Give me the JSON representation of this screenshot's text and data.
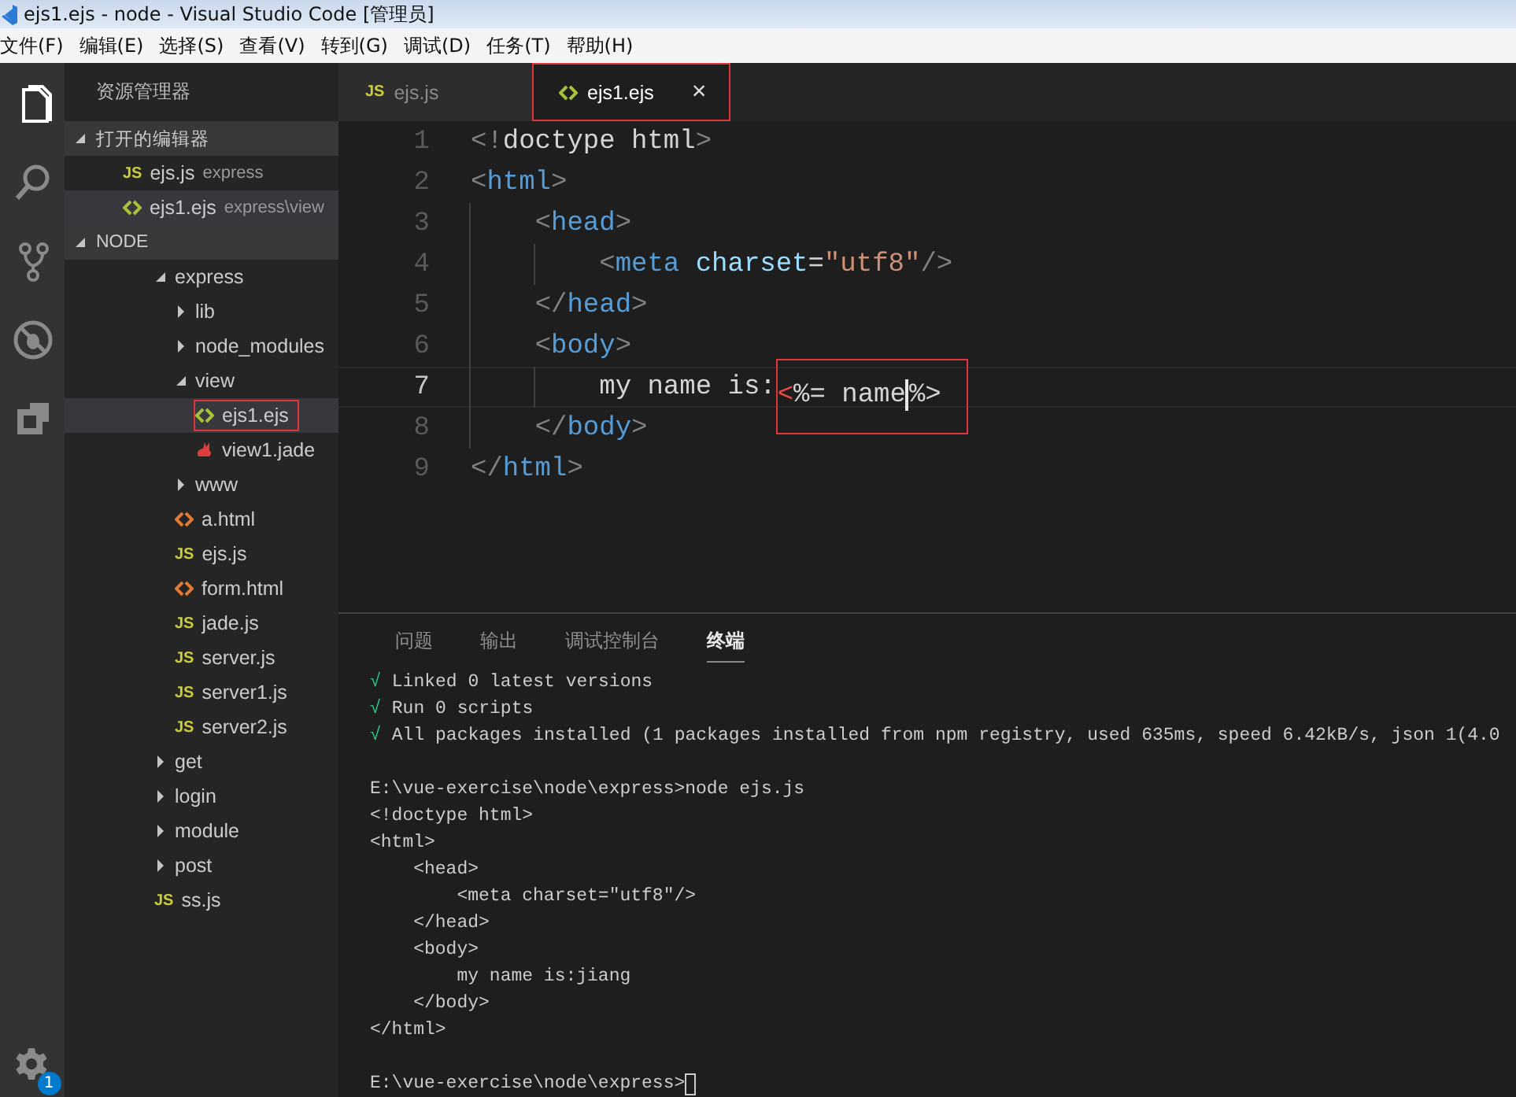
{
  "window": {
    "title": "ejs1.ejs - node - Visual Studio Code [管理员]"
  },
  "menu": [
    "文件(F)",
    "编辑(E)",
    "选择(S)",
    "查看(V)",
    "转到(G)",
    "调试(D)",
    "任务(T)",
    "帮助(H)"
  ],
  "activity_bar": {
    "items": [
      {
        "kind": "files",
        "selected": true
      },
      {
        "kind": "search",
        "selected": false
      },
      {
        "kind": "git",
        "selected": false
      },
      {
        "kind": "debug",
        "selected": false
      },
      {
        "kind": "extensions",
        "selected": false
      }
    ],
    "settings_badge": "1"
  },
  "sidebar": {
    "title": "资源管理器",
    "open_editors": {
      "title": "打开的编辑器",
      "expanded": true,
      "items": [
        {
          "name": "ejs.js",
          "path": "express",
          "kind": "js",
          "icon_text": "JS",
          "selected": false
        },
        {
          "name": "ejs1.ejs",
          "path": "express\\view",
          "kind": "ejs",
          "selected": true
        }
      ]
    },
    "folder": {
      "title": "NODE",
      "expanded": true,
      "items": [
        {
          "name": "express",
          "kind": "folder",
          "expanded": true,
          "selected": false,
          "highlighted": false,
          "children": [
            {
              "name": "lib",
              "kind": "folder",
              "expanded": false,
              "selected": false,
              "highlighted": false
            },
            {
              "name": "node_modules",
              "kind": "folder",
              "expanded": false,
              "selected": false,
              "highlighted": false
            },
            {
              "name": "view",
              "kind": "folder",
              "expanded": true,
              "selected": false,
              "highlighted": false,
              "children": [
                {
                  "name": "ejs1.ejs",
                  "kind": "ejs",
                  "selected": true,
                  "highlighted": true
                },
                {
                  "name": "view1.jade",
                  "kind": "jade",
                  "selected": false,
                  "highlighted": false
                }
              ]
            },
            {
              "name": "www",
              "kind": "folder",
              "expanded": false,
              "selected": false,
              "highlighted": false
            },
            {
              "name": "a.html",
              "kind": "html",
              "selected": false,
              "highlighted": false
            },
            {
              "name": "ejs.js",
              "kind": "js",
              "icon_text": "JS",
              "selected": false,
              "highlighted": false
            },
            {
              "name": "form.html",
              "kind": "html",
              "selected": false,
              "highlighted": false
            },
            {
              "name": "jade.js",
              "kind": "js",
              "icon_text": "JS",
              "selected": false,
              "highlighted": false
            },
            {
              "name": "server.js",
              "kind": "js",
              "icon_text": "JS",
              "selected": false,
              "highlighted": false
            },
            {
              "name": "server1.js",
              "kind": "js",
              "icon_text": "JS",
              "selected": false,
              "highlighted": false
            },
            {
              "name": "server2.js",
              "kind": "js",
              "icon_text": "JS",
              "selected": false,
              "highlighted": false
            }
          ]
        },
        {
          "name": "get",
          "kind": "folder",
          "expanded": false,
          "selected": false,
          "highlighted": false
        },
        {
          "name": "login",
          "kind": "folder",
          "expanded": false,
          "selected": false,
          "highlighted": false
        },
        {
          "name": "module",
          "kind": "folder",
          "expanded": false,
          "selected": false,
          "highlighted": false
        },
        {
          "name": "post",
          "kind": "folder",
          "expanded": false,
          "selected": false,
          "highlighted": false
        },
        {
          "name": "ss.js",
          "kind": "js",
          "icon_text": "JS",
          "selected": false,
          "highlighted": false
        }
      ]
    }
  },
  "editor": {
    "tabs": [
      {
        "name": "ejs.js",
        "kind": "js",
        "icon_text": "JS",
        "selected": false,
        "highlighted": false
      },
      {
        "name": "ejs1.ejs",
        "kind": "ejs",
        "selected": true,
        "highlighted": true,
        "close": "×"
      }
    ],
    "lines": [
      {
        "number": "1",
        "current": false,
        "tokens": [
          {
            "t": "<!",
            "kind": "punct"
          },
          {
            "t": "doctype html",
            "kind": "text"
          },
          {
            "t": ">",
            "kind": "punct"
          }
        ]
      },
      {
        "number": "2",
        "current": false,
        "tokens": [
          {
            "t": "<",
            "kind": "punct"
          },
          {
            "t": "html",
            "kind": "tag"
          },
          {
            "t": ">",
            "kind": "punct"
          }
        ]
      },
      {
        "number": "3",
        "current": false,
        "tokens": [
          {
            "t": "    <",
            "kind": "punct"
          },
          {
            "t": "head",
            "kind": "tag"
          },
          {
            "t": ">",
            "kind": "punct"
          }
        ]
      },
      {
        "number": "4",
        "current": false,
        "tokens": [
          {
            "t": "        <",
            "kind": "punct"
          },
          {
            "t": "meta",
            "kind": "tag"
          },
          {
            "t": " charset",
            "kind": "attr"
          },
          {
            "t": "=",
            "kind": "text"
          },
          {
            "t": "\"utf8\"",
            "kind": "string"
          },
          {
            "t": "/>",
            "kind": "punct"
          }
        ]
      },
      {
        "number": "5",
        "current": false,
        "tokens": [
          {
            "t": "    </",
            "kind": "punct"
          },
          {
            "t": "head",
            "kind": "tag"
          },
          {
            "t": ">",
            "kind": "punct"
          }
        ]
      },
      {
        "number": "6",
        "current": false,
        "tokens": [
          {
            "t": "    <",
            "kind": "punct"
          },
          {
            "t": "body",
            "kind": "tag"
          },
          {
            "t": ">",
            "kind": "punct"
          }
        ]
      },
      {
        "number": "7",
        "current": true,
        "tokens": [
          {
            "t": "        my name is:",
            "kind": "text"
          },
          {
            "t": "<",
            "kind": "error",
            "boxed": true
          },
          {
            "t": "%= name",
            "kind": "text",
            "boxed": true
          },
          {
            "t": "%>",
            "kind": "text",
            "boxed": true,
            "caret": true
          }
        ]
      },
      {
        "number": "8",
        "current": false,
        "tokens": [
          {
            "t": "    </",
            "kind": "punct"
          },
          {
            "t": "body",
            "kind": "tag"
          },
          {
            "t": ">",
            "kind": "punct"
          }
        ]
      },
      {
        "number": "9",
        "current": false,
        "tokens": [
          {
            "t": "</",
            "kind": "punct"
          },
          {
            "t": "html",
            "kind": "tag"
          },
          {
            "t": ">",
            "kind": "punct"
          }
        ]
      }
    ]
  },
  "panel": {
    "tabs": [
      {
        "label": "问题",
        "selected": false
      },
      {
        "label": "输出",
        "selected": false
      },
      {
        "label": "调试控制台",
        "selected": false
      },
      {
        "label": "终端",
        "selected": true
      }
    ],
    "terminal": {
      "cursor": true,
      "blocks": [
        [
          {
            "check": "√",
            "text": "Linked 0 latest versions"
          },
          {
            "check": "√",
            "text": "Run 0 scripts"
          },
          {
            "check": "√",
            "text": "All packages installed (1 packages installed from npm registry, used 635ms, speed 6.42kB/s, json 1(4.0"
          }
        ],
        [
          {
            "text": "E:\\vue-exercise\\node\\express>node ejs.js"
          },
          {
            "text": "<!doctype html>"
          },
          {
            "text": "<html>"
          },
          {
            "text": "    <head>"
          },
          {
            "text": "        <meta charset=\"utf8\"/>"
          },
          {
            "text": "    </head>"
          },
          {
            "text": "    <body>"
          },
          {
            "text": "        my name is:jiang"
          },
          {
            "text": "    </body>"
          },
          {
            "text": "</html>"
          }
        ],
        [
          {
            "text": "E:\\vue-exercise\\node\\express>"
          }
        ]
      ]
    }
  }
}
